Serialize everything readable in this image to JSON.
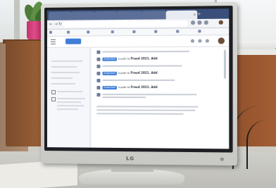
{
  "scene": {
    "monitor_brand": "LG",
    "colors": {
      "browser_tab_bar": "#3a4f7a",
      "accent": "#3f7ed8",
      "screen_bg": "#e8ebf1"
    }
  },
  "browser": {
    "tabs": [
      {
        "label": "",
        "active": false
      },
      {
        "label": "",
        "active": false
      },
      {
        "label": "",
        "active": false
      },
      {
        "label": "",
        "active": false
      },
      {
        "label": "",
        "active": false
      },
      {
        "label": "",
        "active": true
      }
    ],
    "new_tab_icon": "plus-icon"
  },
  "app": {
    "primary_button": "",
    "sidebar": {
      "title": "",
      "items": []
    },
    "feed": [
      {
        "icon": "document-icon",
        "tag": "",
        "text": "",
        "bold": ""
      },
      {
        "icon": "document-icon",
        "tag": "Expected",
        "text": "a path to",
        "bold": "Fraud 2021. Add"
      },
      {
        "icon": "document-icon",
        "tag": "",
        "text": "",
        "bold": ""
      },
      {
        "icon": "document-icon",
        "tag": "Expected",
        "text": "a path to",
        "bold": "Fraud 2021. Add"
      },
      {
        "icon": "document-icon",
        "tag": "",
        "text": "",
        "bold": ""
      },
      {
        "icon": "document-icon",
        "tag": "Expected",
        "text": "a path to",
        "bold": "Fraud 2021. Add"
      },
      {
        "icon": "document-icon",
        "tag": "",
        "text": "",
        "bold": ""
      }
    ],
    "paragraph": ""
  }
}
